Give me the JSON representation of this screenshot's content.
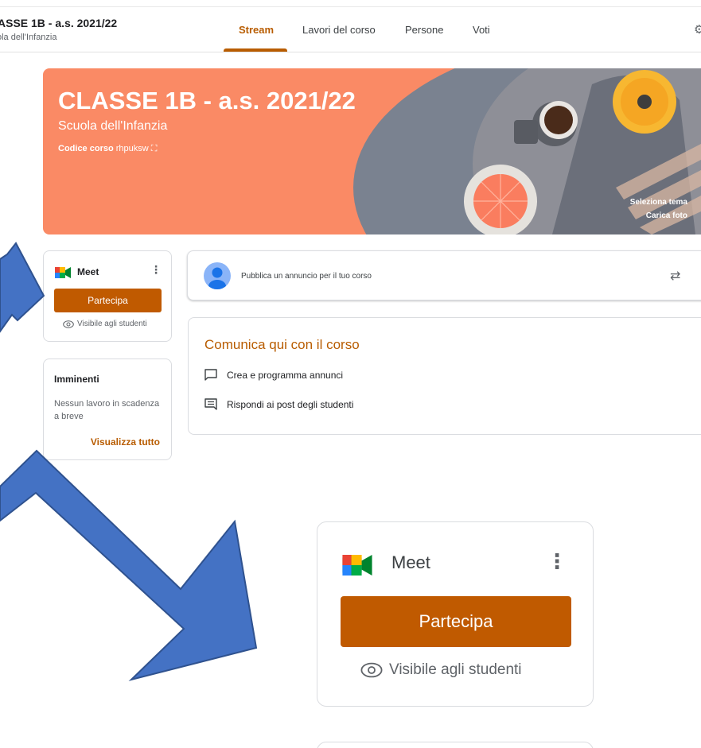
{
  "header": {
    "course_title": "ASSE 1B - a.s. 2021/22",
    "course_subtitle": "ola dell'Infanzia",
    "tabs": [
      {
        "label": "Stream",
        "active": true
      },
      {
        "label": "Lavori del corso",
        "active": false
      },
      {
        "label": "Persone",
        "active": false
      },
      {
        "label": "Voti",
        "active": false
      }
    ],
    "settings_icon": "gear-icon"
  },
  "banner": {
    "title": "CLASSE 1B - a.s. 2021/22",
    "school": "Scuola dell'Infanzia",
    "code_label": "Codice corso",
    "code_value": "rhpuksw",
    "select_theme": "Seleziona tema",
    "upload_photo": "Carica foto",
    "color": "#fa8a65"
  },
  "meet": {
    "label": "Meet",
    "join_button": "Partecipa",
    "visibility": "Visibile agli studenti",
    "icon": "google-meet-icon"
  },
  "upcoming": {
    "title": "Imminenti",
    "text": "Nessun lavoro in scadenza a breve",
    "link": "Visualizza tutto"
  },
  "announce": {
    "placeholder": "Pubblica un annuncio per il tuo corso"
  },
  "communicate": {
    "title": "Comunica qui con il corso",
    "items": [
      {
        "label": "Crea e programma annunci",
        "icon": "chat-bubble-icon"
      },
      {
        "label": "Rispondi ai post degli studenti",
        "icon": "message-lines-icon"
      }
    ]
  },
  "theme": {
    "accent": "#b85c00",
    "button": "#c05a00",
    "arrow": "#4472c4"
  }
}
